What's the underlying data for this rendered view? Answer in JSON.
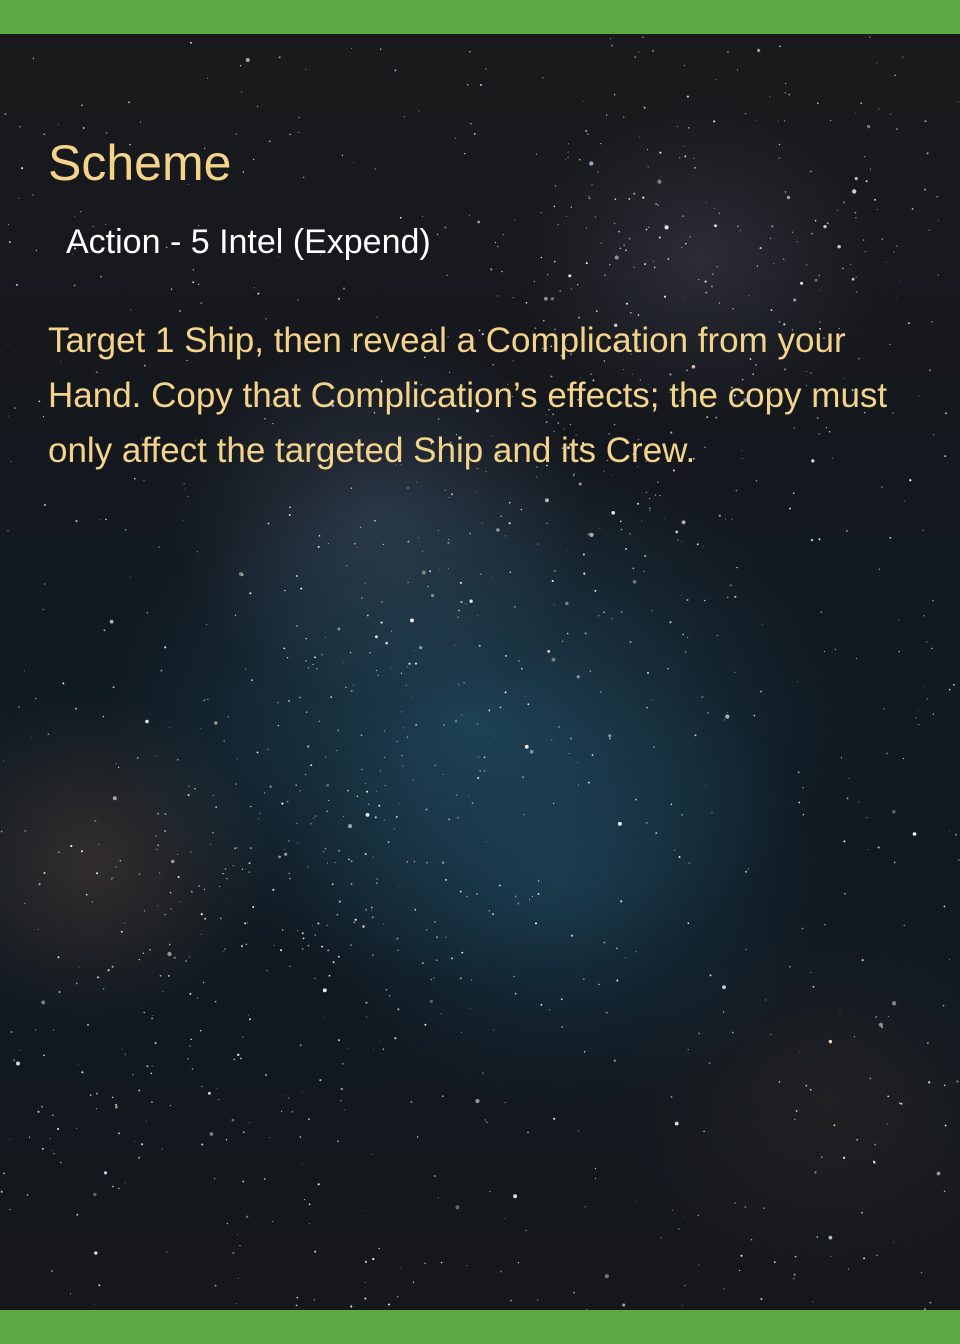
{
  "card": {
    "title": "Scheme",
    "subtitle": "Action - 5 Intel (Expend)",
    "description": "Target 1 Ship, then reveal a Complication from your Hand. Copy that Complication’s effects; the copy must only affect the targeted Ship and its Crew."
  },
  "colors": {
    "border_bar": "#5aa943",
    "title_text": "#f4d38a",
    "subtitle_text": "#ffffff",
    "body_text": "#f4d38a"
  }
}
